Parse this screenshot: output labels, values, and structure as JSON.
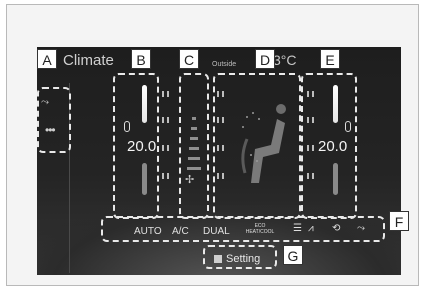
{
  "screen": {
    "title": "Climate",
    "outside_label": "Outside",
    "outside_value": "3°C"
  },
  "left_zone": {
    "temperature": "20.0"
  },
  "right_zone": {
    "temperature": "20.0"
  },
  "bottom_buttons": [
    {
      "label": "AUTO"
    },
    {
      "label": "A/C"
    },
    {
      "label": "DUAL"
    },
    {
      "label": "ECO HEAT/COOL"
    }
  ],
  "setting_button": {
    "label": "Setting"
  },
  "callouts": [
    "A",
    "B",
    "C",
    "D",
    "E",
    "F",
    "G"
  ],
  "icons": {
    "fan": "fan-icon",
    "left_mode": "seat-airflow-icon",
    "left_more": "more-dots-icon",
    "defroster_rear": "rear-defroster-icon",
    "defroster_front": "front-defroster-icon",
    "air_recirc": "recirculation-icon",
    "passenger": "seated-passenger-icon",
    "setting": "gear-icon"
  }
}
